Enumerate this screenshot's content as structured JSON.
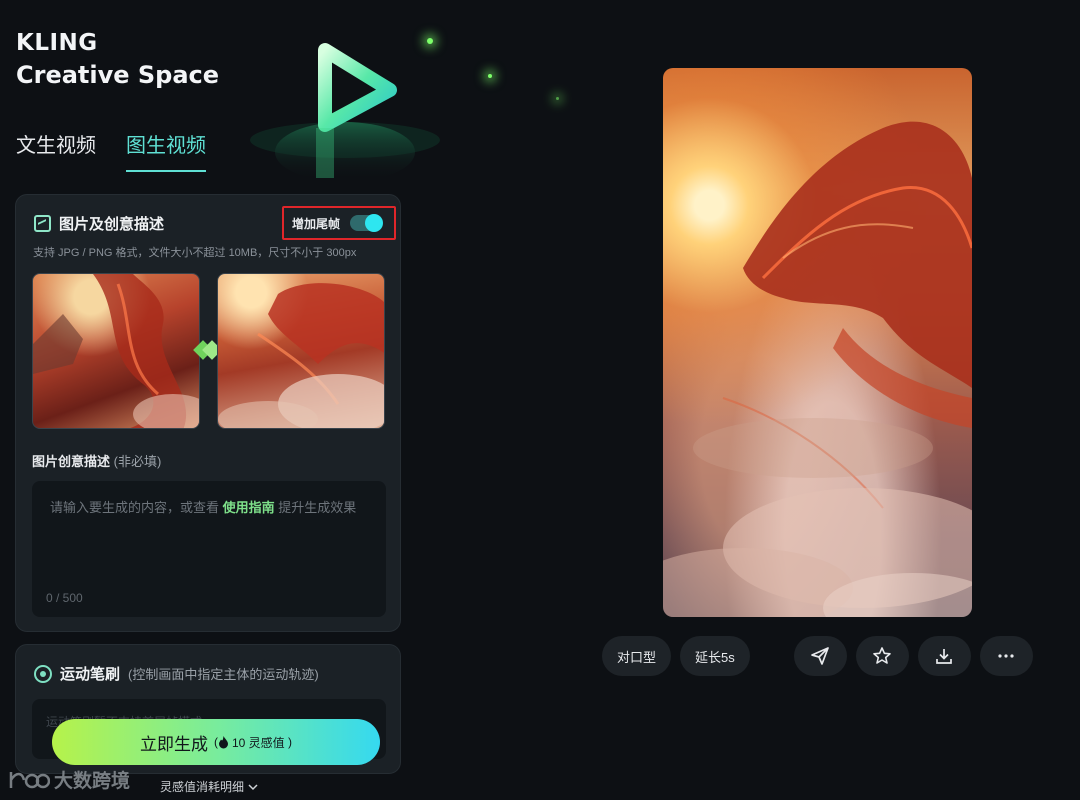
{
  "brand": {
    "line1": "KLING",
    "line2": "Creative Space"
  },
  "tabs": [
    {
      "label": "文生视频",
      "active": false
    },
    {
      "label": "图生视频",
      "active": true
    }
  ],
  "upload": {
    "title": "图片及创意描述",
    "tail_frame_label": "增加尾帧",
    "tail_frame_enabled": true,
    "hint": "支持 JPG / PNG 格式，文件大小不超过 10MB，尺寸不小于 300px"
  },
  "description": {
    "label": "图片创意描述",
    "optional": "(非必填)",
    "placeholder_before": "请输入要生成的内容，或查看 ",
    "placeholder_link": "使用指南",
    "placeholder_after": " 提升生成效果",
    "counter": "0 / 500"
  },
  "motion_brush": {
    "title": "运动笔刷",
    "subtitle": "(控制画面中指定主体的运动轨迹)",
    "placeholder": "运动笔刷暂不支持首尾帧模式"
  },
  "generate": {
    "label": "立即生成",
    "cost": "10 灵感值"
  },
  "points_detail": "灵感值消耗明细",
  "watermark": "大数跨境",
  "actions": {
    "lip_sync": "对口型",
    "extend": "延长5s"
  },
  "icons": [
    "image-icon",
    "brush-icon",
    "flame-icon",
    "send-icon",
    "star-icon",
    "download-icon",
    "more-icon",
    "chevron-down-icon"
  ],
  "colors": {
    "accent": "#5fe0d4",
    "highlight_box": "#e0262a",
    "gradient_start": "#b6f24a",
    "gradient_end": "#35d9f0"
  }
}
